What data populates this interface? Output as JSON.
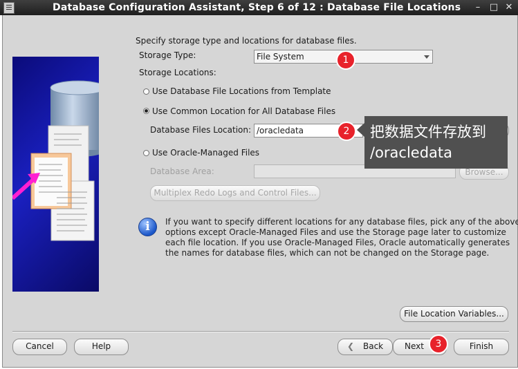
{
  "window": {
    "title": "Database Configuration Assistant, Step 6 of 12 : Database File Locations",
    "controls": {
      "minimize": "–",
      "maximize": "□",
      "close": "✕"
    }
  },
  "content": {
    "intro": "Specify storage type and locations for database files.",
    "storage_type_label": "Storage Type:",
    "storage_type_value": "File System",
    "storage_locations_label": "Storage Locations:",
    "options": {
      "template": "Use Database File Locations from Template",
      "common": "Use Common Location for All Database Files",
      "omf": "Use Oracle-Managed Files"
    },
    "db_files_location_label": "Database Files Location:",
    "db_files_location_value": "/oracledata",
    "db_area_label": "Database Area:",
    "db_area_value": "",
    "browse_label": "Browse...",
    "multiplex_label": "Multiplex Redo Logs and Control Files...",
    "info_lines": [
      "If you want to specify different locations for any database files, pick any of the above",
      "options except Oracle-Managed Files and use the Storage page later to customize",
      "each file location. If you use Oracle-Managed Files, Oracle automatically generates",
      "the names for database files, which can not be changed on the Storage page."
    ],
    "file_location_variables_label": "File Location Variables..."
  },
  "footer": {
    "cancel": "Cancel",
    "help": "Help",
    "back": "Back",
    "next": "Next",
    "finish": "Finish"
  },
  "annotations": {
    "step1": "1",
    "step2": "2",
    "step3": "3",
    "note_line1": "把数据文件存放到",
    "note_line2": "/oracledata"
  },
  "colors": {
    "title_bar": "#2a2a2a",
    "panel_bg": "#d6d6d6",
    "side_panel": "#1a20c0",
    "badge": "#e8222b",
    "note_bg": "#505050",
    "info_icon": "#1b57c9"
  }
}
